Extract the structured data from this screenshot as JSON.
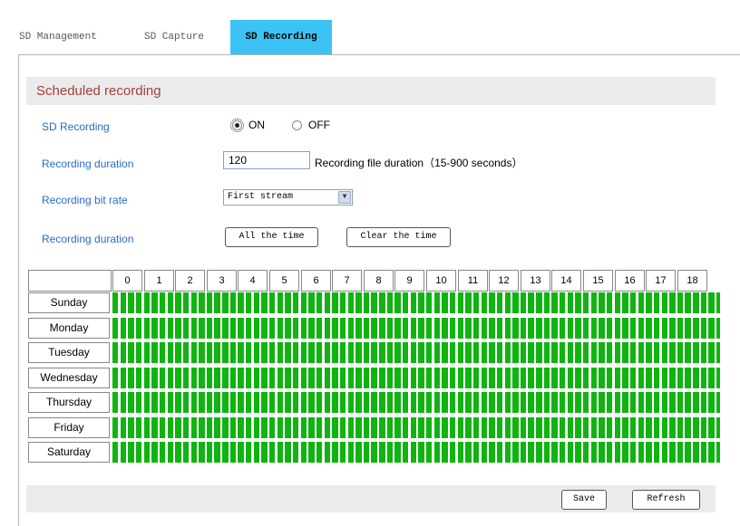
{
  "tabs": [
    {
      "label": "SD Management",
      "active": false
    },
    {
      "label": "SD Capture",
      "active": false
    },
    {
      "label": "SD Recording",
      "active": true
    }
  ],
  "section": {
    "title": "Scheduled recording"
  },
  "form": {
    "sd_recording": {
      "label": "SD Recording",
      "on_label": "ON",
      "off_label": "OFF",
      "selected": "ON"
    },
    "duration": {
      "label": "Recording duration",
      "value": "120",
      "note": "Recording file duration（15-900 seconds）"
    },
    "bitrate": {
      "label": "Recording bit rate",
      "value": "First stream"
    },
    "schedule": {
      "label": "Recording duration",
      "all_label": "All the time",
      "clear_label": "Clear the time"
    }
  },
  "schedule_grid": {
    "hours": [
      "0",
      "1",
      "2",
      "3",
      "4",
      "5",
      "6",
      "7",
      "8",
      "9",
      "10",
      "11",
      "12",
      "13",
      "14",
      "15",
      "16",
      "17",
      "18"
    ],
    "days": [
      "Sunday",
      "Monday",
      "Tuesday",
      "Wednesday",
      "Thursday",
      "Friday",
      "Saturday"
    ],
    "all_selected": true,
    "selected_color": "#10b410"
  },
  "footer": {
    "save_label": "Save",
    "refresh_label": "Refresh"
  }
}
